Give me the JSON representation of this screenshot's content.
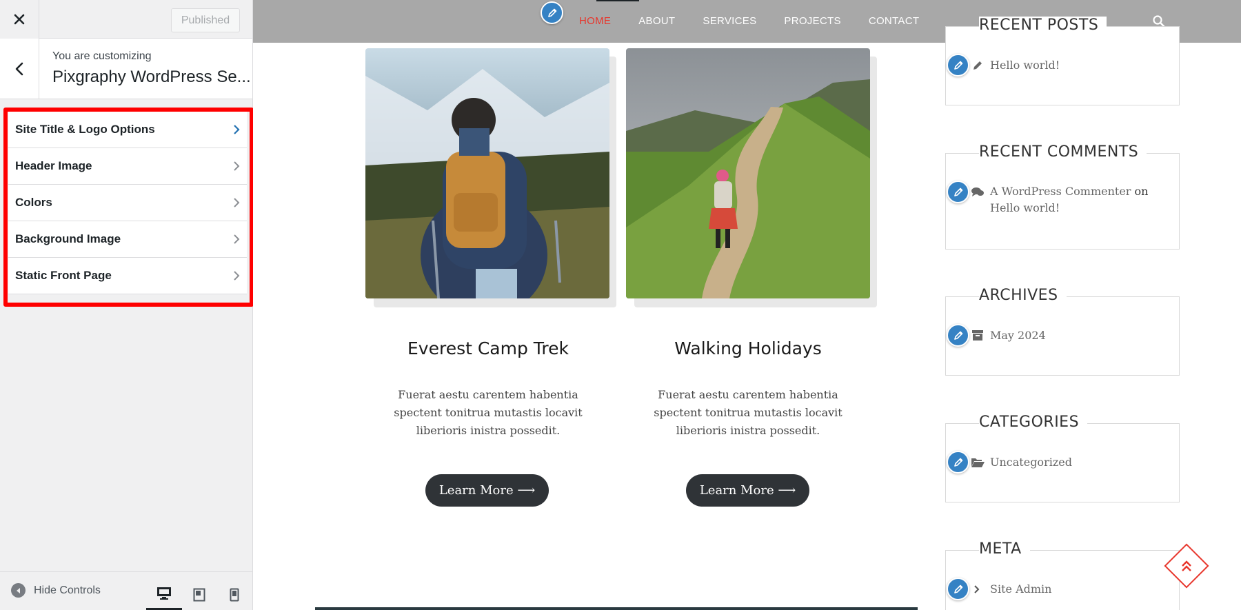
{
  "sidebar": {
    "publish_label": "Published",
    "customizing_label": "You are customizing",
    "site_name": "Pixgraphy WordPress Se...",
    "panels": [
      {
        "label": "Site Title & Logo Options"
      },
      {
        "label": "Header Image"
      },
      {
        "label": "Colors"
      },
      {
        "label": "Background Image"
      },
      {
        "label": "Static Front Page"
      }
    ],
    "hide_controls_label": "Hide Controls",
    "highlight_color": "#ff0000"
  },
  "preview": {
    "nav": [
      "HOME",
      "ABOUT",
      "SERVICES",
      "PROJECTS",
      "CONTACT"
    ],
    "nav_active_color": "#e8352b",
    "cards": [
      {
        "title": "Everest Camp Trek",
        "text": "Fuerat aestu carentem habentia spectent tonitrua mutastis locavit liberioris inistra possedit.",
        "button": "Learn More ⟶"
      },
      {
        "title": "Walking Holidays",
        "text": "Fuerat aestu carentem habentia spectent tonitrua mutastis locavit liberioris inistra possedit.",
        "button": "Learn More ⟶"
      }
    ],
    "widgets": {
      "recent_posts": {
        "title": "RECENT POSTS",
        "item": "Hello world!"
      },
      "recent_comments": {
        "title": "RECENT COMMENTS",
        "author": "A WordPress Commenter",
        "on": "on",
        "post": "Hello world!"
      },
      "archives": {
        "title": "ARCHIVES",
        "item": "May 2024"
      },
      "categories": {
        "title": "CATEGORIES",
        "item": "Uncategorized"
      },
      "meta": {
        "title": "META",
        "item": "Site Admin"
      }
    },
    "accent_color": "#3582c4"
  }
}
